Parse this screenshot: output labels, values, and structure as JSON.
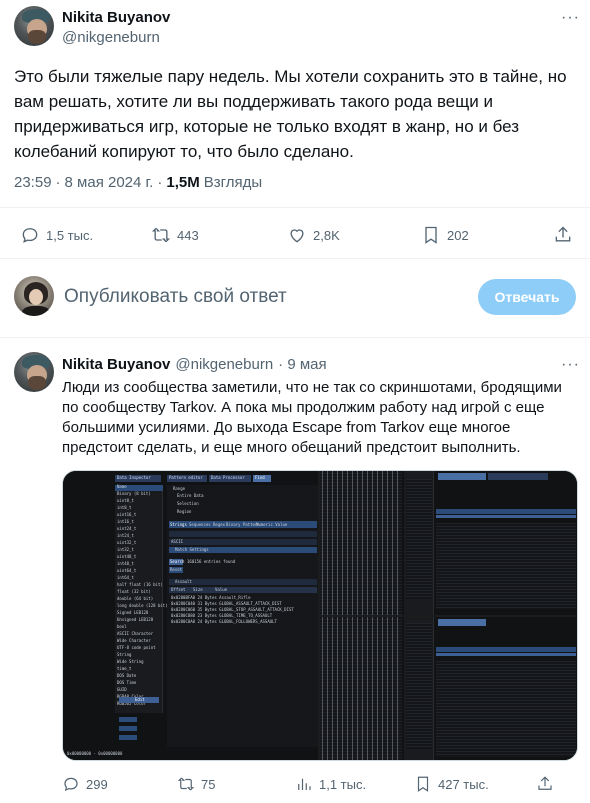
{
  "tweet": {
    "author_name": "Nikita Buyanov",
    "author_handle": "@nikgeneburn",
    "more_label": "···",
    "text": "Это были тяжелые пару недель. Мы хотели сохранить это в тайне, но вам решать, хотите ли вы поддерживать такого рода вещи и придерживаться игр, которые не только входят в жанр, но и без колебаний копируют то, что было сделано.",
    "time": "23:59",
    "dot": "·",
    "date": "8 мая 2024 г.",
    "views_count": "1,5M",
    "views_label": "Взгляды",
    "replies": "1,5 тыс.",
    "retweets": "443",
    "likes": "2,8K",
    "bookmarks": "202"
  },
  "reply_box": {
    "placeholder": "Опубликовать свой ответ",
    "button_label": "Отвечать"
  },
  "reply_tweet": {
    "author_name": "Nikita Buyanov",
    "author_handle": "@nikgeneburn",
    "date": "· 9 мая",
    "more_label": "···",
    "text": "Люди из сообщества заметили, что не так со скриншотами, бродящими по сообществу Tarkov. А пока мы продолжим работу над игрой с еще большими усилиями. До выхода Escape from Tarkov еще многое предстоит сделать, и еще много обещаний предстоит выполнить.",
    "replies": "299",
    "retweets": "75",
    "views": "1,1 тыс.",
    "bookmarks": "427 тыс."
  },
  "media": {
    "left_tabs": [
      "Data Inspector",
      "Pattern editor",
      "Data Processor",
      "Find"
    ],
    "inspector_rows": [
      "Name",
      "Binary (8 bit)",
      "uint8_t",
      "int8_t",
      "uint16_t",
      "int16_t",
      "uint24_t",
      "int24_t",
      "uint32_t",
      "int32_t",
      "uint48_t",
      "int48_t",
      "uint64_t",
      "int64_t",
      "half float (16 bit)",
      "float (32 bit)",
      "double (64 bit)",
      "long double (128 bit)",
      "Signed LEB128",
      "Unsigned LEB128",
      "bool",
      "ASCII Character",
      "Wide Character",
      "UTF-8 code point",
      "String",
      "Wide String",
      "time_t",
      "DOS Date",
      "DOS Time",
      "GUID",
      "RGBA8 Color",
      "RGB565 Color"
    ],
    "find_range_label": "Range",
    "find_options": [
      "Entire Data",
      "Selection",
      "Region"
    ],
    "find_tabs": [
      "Strings",
      "Sequences",
      "Regex",
      "Binary Pattern",
      "Numeric Value"
    ],
    "find_encoding": "ASCII",
    "find_settings": "Match Settings",
    "find_search": "Search",
    "find_result": "160156 entries found",
    "find_reset": "Reset",
    "filter_value": "Assault",
    "result_headers": [
      "Offset",
      "Size",
      "Value"
    ],
    "result_rows": [
      "0x0280BFA0  24 Bytes  Assault_Rifle",
      "0x0280C040  31 Bytes  GLOBAL_ASSAULT_ATTACK_DIST",
      "0x0280C060  35 Bytes  GLOBAL_STOP_ASSAULT_ATTACK_DIST",
      "0x0280C080  23 Bytes  GLOBAL_TIME_TO_ASSAULT",
      "0x0280C0A0  24 Bytes  GLOBAL_FOLLOWERS_ASSAULT"
    ],
    "status_left": "0x00000000 - 0x00000000",
    "edit_label": "Edit"
  }
}
